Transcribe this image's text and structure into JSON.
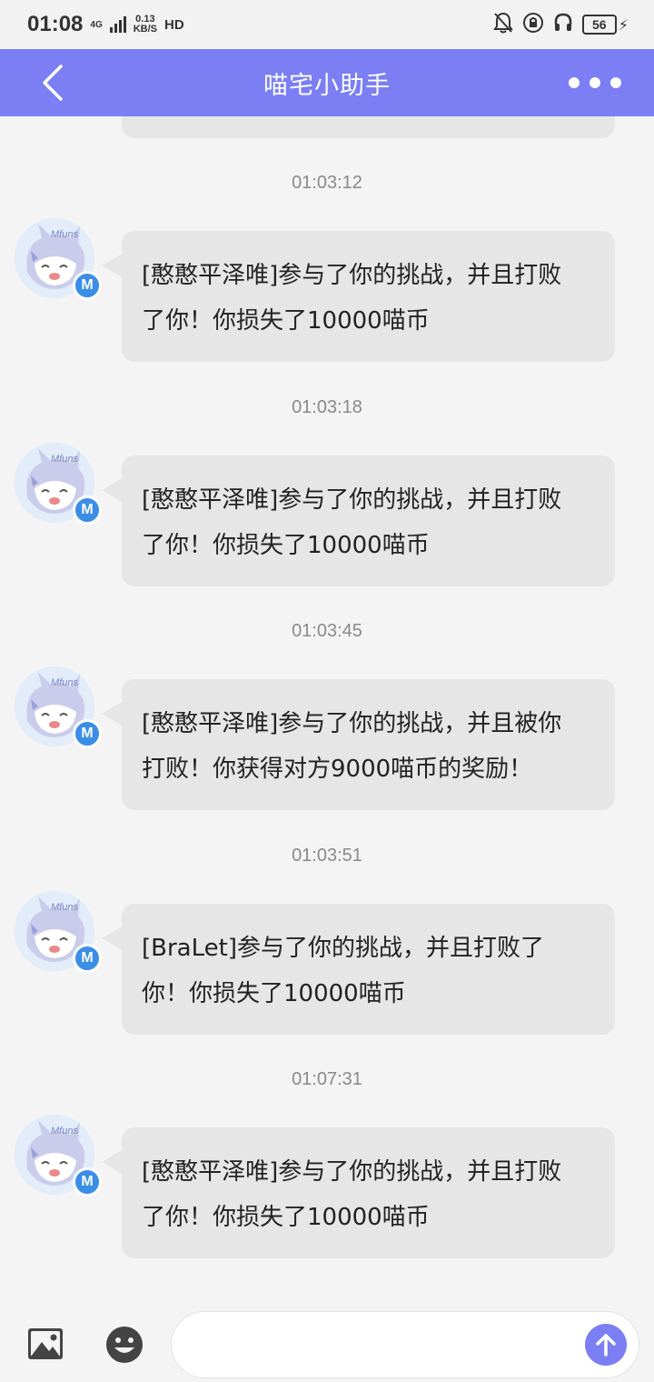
{
  "status_bar": {
    "time": "01:08",
    "network_type": "4G",
    "net_speed_value": "0.13",
    "net_speed_unit": "KB/S",
    "hd_label": "HD",
    "battery_level": "56",
    "icons": [
      "mute-bell-icon",
      "lock-rotation-icon",
      "headset-icon",
      "battery-icon",
      "charging-bolt-icon"
    ]
  },
  "header": {
    "title": "喵宅小助手",
    "back_icon": "chevron-left-icon",
    "more_icon": "more-dots-icon",
    "background": "#7b7ff3"
  },
  "avatar": {
    "text": "Mfuns",
    "badge": "M"
  },
  "messages": [
    {
      "time": "01:03:12",
      "line1": "[憨憨平泽唯]参与了你的挑战，并且打败",
      "line2": "了你！你损失了10000喵币"
    },
    {
      "time": "01:03:18",
      "line1": "[憨憨平泽唯]参与了你的挑战，并且打败",
      "line2": "了你！你损失了10000喵币"
    },
    {
      "time": "01:03:45",
      "line1": "[憨憨平泽唯]参与了你的挑战，并且被你",
      "line2": "打败！你获得对方9000喵币的奖励！"
    },
    {
      "time": "01:03:51",
      "line1": "[BraLet]参与了你的挑战，并且打败了",
      "line2": "你！你损失了10000喵币"
    },
    {
      "time": "01:07:31",
      "line1": "[憨憨平泽唯]参与了你的挑战，并且打败",
      "line2": "了你！你损失了10000喵币"
    }
  ],
  "input_bar": {
    "value": "",
    "image_icon": "image-icon",
    "emoji_icon": "emoji-icon",
    "send_icon": "arrow-up-icon"
  }
}
